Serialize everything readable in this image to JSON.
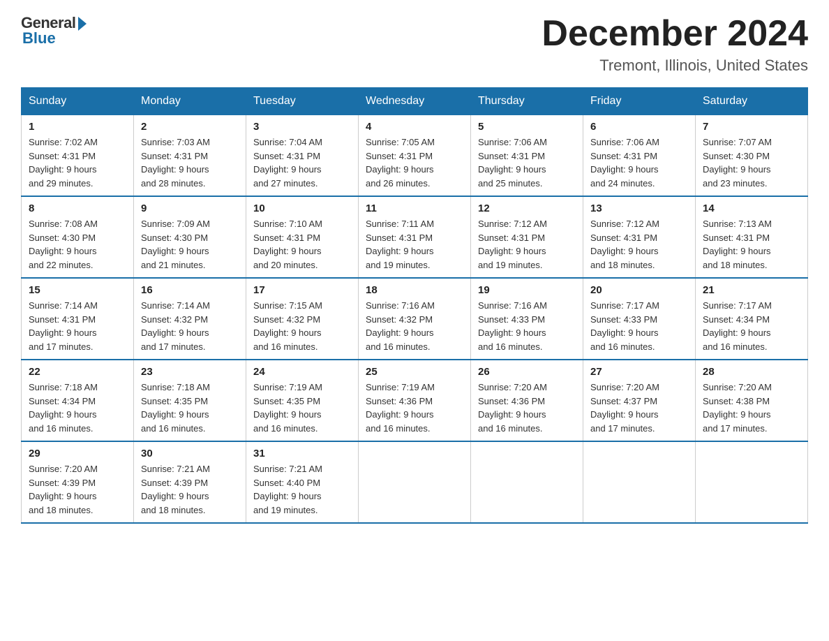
{
  "header": {
    "logo_general": "General",
    "logo_blue": "Blue",
    "month_title": "December 2024",
    "location": "Tremont, Illinois, United States"
  },
  "days_of_week": [
    "Sunday",
    "Monday",
    "Tuesday",
    "Wednesday",
    "Thursday",
    "Friday",
    "Saturday"
  ],
  "weeks": [
    [
      {
        "day": "1",
        "sunrise": "7:02 AM",
        "sunset": "4:31 PM",
        "daylight": "9 hours and 29 minutes."
      },
      {
        "day": "2",
        "sunrise": "7:03 AM",
        "sunset": "4:31 PM",
        "daylight": "9 hours and 28 minutes."
      },
      {
        "day": "3",
        "sunrise": "7:04 AM",
        "sunset": "4:31 PM",
        "daylight": "9 hours and 27 minutes."
      },
      {
        "day": "4",
        "sunrise": "7:05 AM",
        "sunset": "4:31 PM",
        "daylight": "9 hours and 26 minutes."
      },
      {
        "day": "5",
        "sunrise": "7:06 AM",
        "sunset": "4:31 PM",
        "daylight": "9 hours and 25 minutes."
      },
      {
        "day": "6",
        "sunrise": "7:06 AM",
        "sunset": "4:31 PM",
        "daylight": "9 hours and 24 minutes."
      },
      {
        "day": "7",
        "sunrise": "7:07 AM",
        "sunset": "4:30 PM",
        "daylight": "9 hours and 23 minutes."
      }
    ],
    [
      {
        "day": "8",
        "sunrise": "7:08 AM",
        "sunset": "4:30 PM",
        "daylight": "9 hours and 22 minutes."
      },
      {
        "day": "9",
        "sunrise": "7:09 AM",
        "sunset": "4:30 PM",
        "daylight": "9 hours and 21 minutes."
      },
      {
        "day": "10",
        "sunrise": "7:10 AM",
        "sunset": "4:31 PM",
        "daylight": "9 hours and 20 minutes."
      },
      {
        "day": "11",
        "sunrise": "7:11 AM",
        "sunset": "4:31 PM",
        "daylight": "9 hours and 19 minutes."
      },
      {
        "day": "12",
        "sunrise": "7:12 AM",
        "sunset": "4:31 PM",
        "daylight": "9 hours and 19 minutes."
      },
      {
        "day": "13",
        "sunrise": "7:12 AM",
        "sunset": "4:31 PM",
        "daylight": "9 hours and 18 minutes."
      },
      {
        "day": "14",
        "sunrise": "7:13 AM",
        "sunset": "4:31 PM",
        "daylight": "9 hours and 18 minutes."
      }
    ],
    [
      {
        "day": "15",
        "sunrise": "7:14 AM",
        "sunset": "4:31 PM",
        "daylight": "9 hours and 17 minutes."
      },
      {
        "day": "16",
        "sunrise": "7:14 AM",
        "sunset": "4:32 PM",
        "daylight": "9 hours and 17 minutes."
      },
      {
        "day": "17",
        "sunrise": "7:15 AM",
        "sunset": "4:32 PM",
        "daylight": "9 hours and 16 minutes."
      },
      {
        "day": "18",
        "sunrise": "7:16 AM",
        "sunset": "4:32 PM",
        "daylight": "9 hours and 16 minutes."
      },
      {
        "day": "19",
        "sunrise": "7:16 AM",
        "sunset": "4:33 PM",
        "daylight": "9 hours and 16 minutes."
      },
      {
        "day": "20",
        "sunrise": "7:17 AM",
        "sunset": "4:33 PM",
        "daylight": "9 hours and 16 minutes."
      },
      {
        "day": "21",
        "sunrise": "7:17 AM",
        "sunset": "4:34 PM",
        "daylight": "9 hours and 16 minutes."
      }
    ],
    [
      {
        "day": "22",
        "sunrise": "7:18 AM",
        "sunset": "4:34 PM",
        "daylight": "9 hours and 16 minutes."
      },
      {
        "day": "23",
        "sunrise": "7:18 AM",
        "sunset": "4:35 PM",
        "daylight": "9 hours and 16 minutes."
      },
      {
        "day": "24",
        "sunrise": "7:19 AM",
        "sunset": "4:35 PM",
        "daylight": "9 hours and 16 minutes."
      },
      {
        "day": "25",
        "sunrise": "7:19 AM",
        "sunset": "4:36 PM",
        "daylight": "9 hours and 16 minutes."
      },
      {
        "day": "26",
        "sunrise": "7:20 AM",
        "sunset": "4:36 PM",
        "daylight": "9 hours and 16 minutes."
      },
      {
        "day": "27",
        "sunrise": "7:20 AM",
        "sunset": "4:37 PM",
        "daylight": "9 hours and 17 minutes."
      },
      {
        "day": "28",
        "sunrise": "7:20 AM",
        "sunset": "4:38 PM",
        "daylight": "9 hours and 17 minutes."
      }
    ],
    [
      {
        "day": "29",
        "sunrise": "7:20 AM",
        "sunset": "4:39 PM",
        "daylight": "9 hours and 18 minutes."
      },
      {
        "day": "30",
        "sunrise": "7:21 AM",
        "sunset": "4:39 PM",
        "daylight": "9 hours and 18 minutes."
      },
      {
        "day": "31",
        "sunrise": "7:21 AM",
        "sunset": "4:40 PM",
        "daylight": "9 hours and 19 minutes."
      },
      null,
      null,
      null,
      null
    ]
  ],
  "labels": {
    "sunrise": "Sunrise:",
    "sunset": "Sunset:",
    "daylight": "Daylight:"
  }
}
